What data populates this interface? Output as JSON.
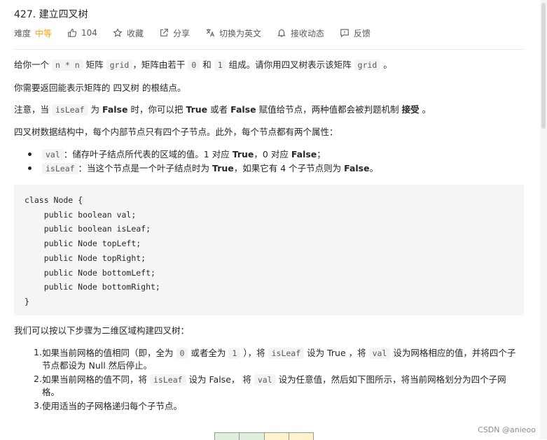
{
  "problem": {
    "title": "427. 建立四叉树"
  },
  "meta": {
    "difficulty_label": "难度",
    "difficulty_value": "中等",
    "likes": "104",
    "favorite": "收藏",
    "share": "分享",
    "switch_lang": "切换为英文",
    "notify": "接收动态",
    "feedback": "反馈",
    "difficulty_color": "#ffa116"
  },
  "desc": {
    "p1": [
      "给你一个",
      "n * n",
      "矩阵",
      "grid",
      "，矩阵由若干",
      "0",
      "和",
      "1",
      "组成。请你用四叉树表示该矩阵",
      "grid",
      "。"
    ],
    "p2": "你需要返回能表示矩阵的 四叉树 的根结点。",
    "p3": [
      "注意，当",
      "isLeaf",
      "为",
      "False",
      "时，你可以把",
      "True",
      "或者",
      "False",
      "赋值给节点，两种值都会被判题机制",
      "接受",
      "。"
    ],
    "p4": "四叉树数据结构中，每个内部节点只有四个子节点。此外，每个节点都有两个属性：",
    "bullets": [
      [
        "val",
        "：储存叶子结点所代表的区域的值。1 对应",
        "True",
        "，0 对应",
        "False",
        "；"
      ],
      [
        "isLeaf",
        "：当这个节点是一个叶子结点时为",
        "True",
        "，如果它有 4 个子节点则为",
        "False",
        "。"
      ]
    ],
    "code": "class Node {\n    public boolean val;\n    public boolean isLeaf;\n    public Node topLeft;\n    public Node topRight;\n    public Node bottomLeft;\n    public Node bottomRight;\n}",
    "p5": "我们可以按以下步骤为二维区域构建四叉树：",
    "steps": [
      {
        "num": "1.",
        "line1": [
          "如果当前网格的值相同（即，全为",
          "0",
          "或者全为",
          "1",
          "），将",
          "isLeaf",
          "设为 True ，将",
          "val",
          "设为网格相应的值，并将四个子"
        ],
        "line2": "节点都设为 Null 然后停止。"
      },
      {
        "num": "2.",
        "line1": [
          "如果当前网格的值不同，将",
          "isLeaf",
          "设为 False， 将",
          "val",
          "设为任意值，然后如下图所示，将当前网格划分为四个子网"
        ],
        "line2": "格。"
      },
      {
        "num": "3.",
        "line1": [
          "使用适当的子网格递归每个子节点。"
        ],
        "line2": ""
      }
    ]
  },
  "watermark": "CSDN @anieoo"
}
